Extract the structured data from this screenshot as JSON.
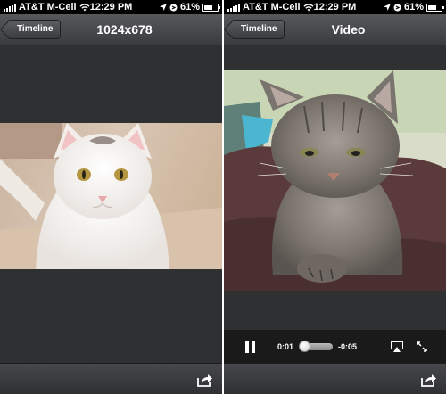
{
  "left_screen": {
    "status": {
      "carrier": "AT&T M-Cell",
      "time": "12:29 PM",
      "battery": "61%",
      "battery_level": 0.61
    },
    "nav": {
      "back_label": "Timeline",
      "title": "1024x678"
    }
  },
  "right_screen": {
    "status": {
      "carrier": "AT&T M-Cell",
      "time": "12:29 PM",
      "battery": "61%",
      "battery_level": 0.61
    },
    "nav": {
      "back_label": "Timeline",
      "title": "Video"
    },
    "video": {
      "elapsed": "0:01",
      "remaining": "-0:05",
      "progress": 0.17
    }
  },
  "colors": {
    "chrome": "#2f3032",
    "status_bar": "#000000",
    "controls": "#1a1a1b"
  },
  "icons": [
    "wifi-icon",
    "location-icon",
    "lock-icon",
    "battery-icon",
    "share-icon",
    "pause-icon",
    "airplay-icon",
    "fullscreen-icon"
  ]
}
